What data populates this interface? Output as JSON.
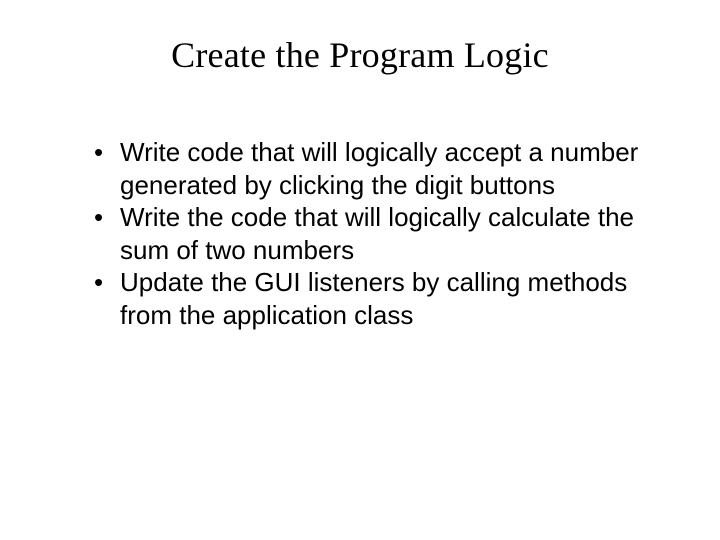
{
  "slide": {
    "title": "Create the Program Logic",
    "bullets": [
      "Write code that will logically accept a number generated by clicking the digit buttons",
      "Write the code that will logically calculate the sum of two numbers",
      "Update the GUI listeners by calling methods from the application class"
    ]
  }
}
